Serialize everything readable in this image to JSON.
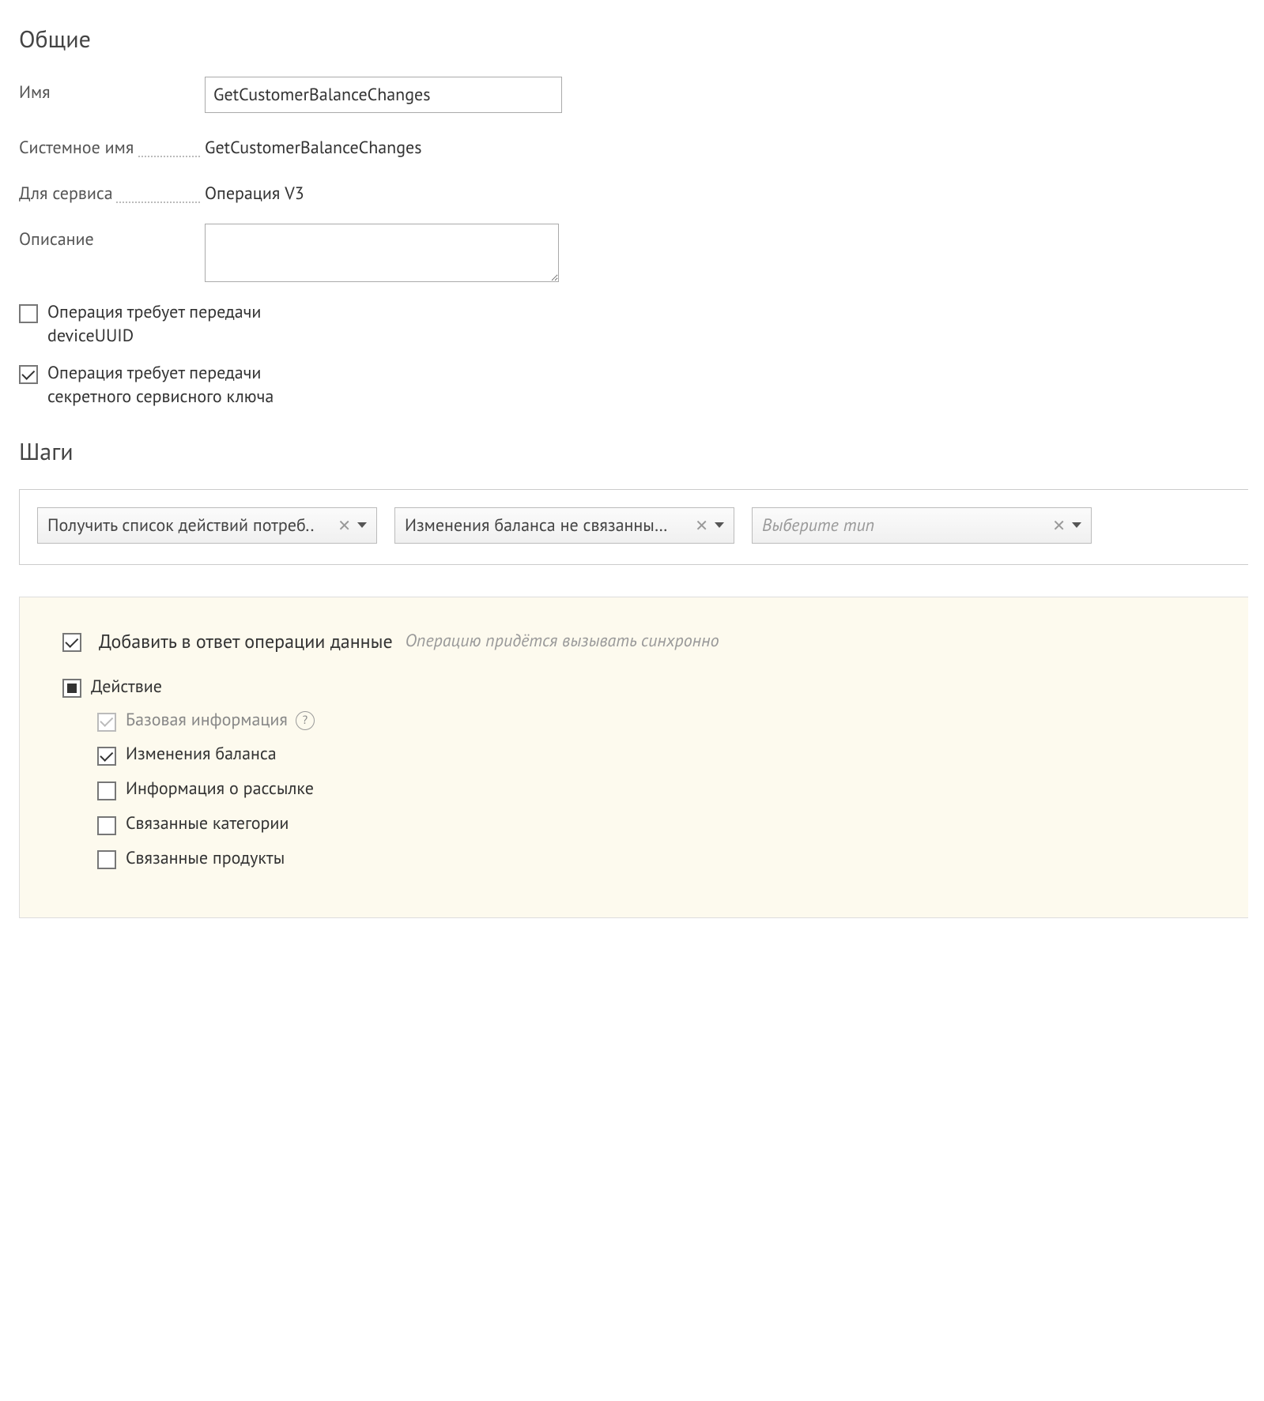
{
  "sections": {
    "general_title": "Общие",
    "steps_title": "Шаги"
  },
  "general": {
    "name_label": "Имя",
    "name_value": "GetCustomerBalanceChanges",
    "system_name_label": "Системное имя",
    "system_name_value": "GetCustomerBalanceChanges",
    "for_service_label": "Для сервиса",
    "for_service_value": "Операция V3",
    "description_label": "Описание",
    "description_value": "",
    "require_device_uuid_label": "Операция требует передачи deviceUUID",
    "require_device_uuid_checked": false,
    "require_secret_key_label": "Операция требует передачи секретного сервисного ключа",
    "require_secret_key_checked": true
  },
  "steps": {
    "items": [
      {
        "label": "Получить список действий потреб.."
      },
      {
        "label": "Изменения баланса не связанные .."
      }
    ],
    "placeholder": "Выберите тип"
  },
  "response": {
    "add_to_response_label": "Добавить в ответ операции данные",
    "add_to_response_checked": true,
    "hint": "Операцию придётся вызывать синхронно",
    "tree": {
      "root_label": "Действие",
      "root_state": "indeterminate",
      "children": [
        {
          "label": "Базовая информация",
          "checked": true,
          "disabled": true,
          "help": true
        },
        {
          "label": "Изменения баланса",
          "checked": true
        },
        {
          "label": "Информация о рассылке",
          "checked": false
        },
        {
          "label": "Связанные категории",
          "checked": false
        },
        {
          "label": "Связанные продукты",
          "checked": false
        }
      ]
    }
  }
}
